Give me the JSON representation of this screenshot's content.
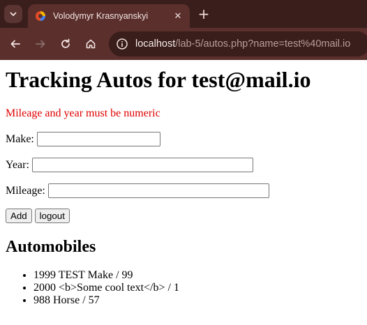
{
  "browser": {
    "tab": {
      "title": "Volodymyr Krasnyanskyi"
    },
    "url": {
      "host": "localhost",
      "path": "/lab-5/autos.php?name=test%40mail.io"
    }
  },
  "page": {
    "heading": "Tracking Autos for test@mail.io",
    "error": "Mileage and year must be numeric",
    "form": {
      "make_label": "Make:",
      "make_value": "",
      "year_label": "Year:",
      "year_value": "",
      "mileage_label": "Mileage:",
      "mileage_value": "",
      "add_label": "Add",
      "logout_label": "logout"
    },
    "list_heading": "Automobiles",
    "autos": [
      "1999 TEST Make / 99",
      "2000 <b>Some cool text</b> / 1",
      "988 Horse / 57"
    ]
  },
  "colors": {
    "error": "#e00000",
    "chrome_dark": "#3a1e1c",
    "chrome_mid": "#5a2f2c"
  },
  "icons": [
    "tab-list-icon",
    "favicon-icon",
    "close-icon",
    "new-tab-icon",
    "back-icon",
    "forward-icon",
    "reload-icon",
    "home-icon",
    "site-info-icon"
  ]
}
